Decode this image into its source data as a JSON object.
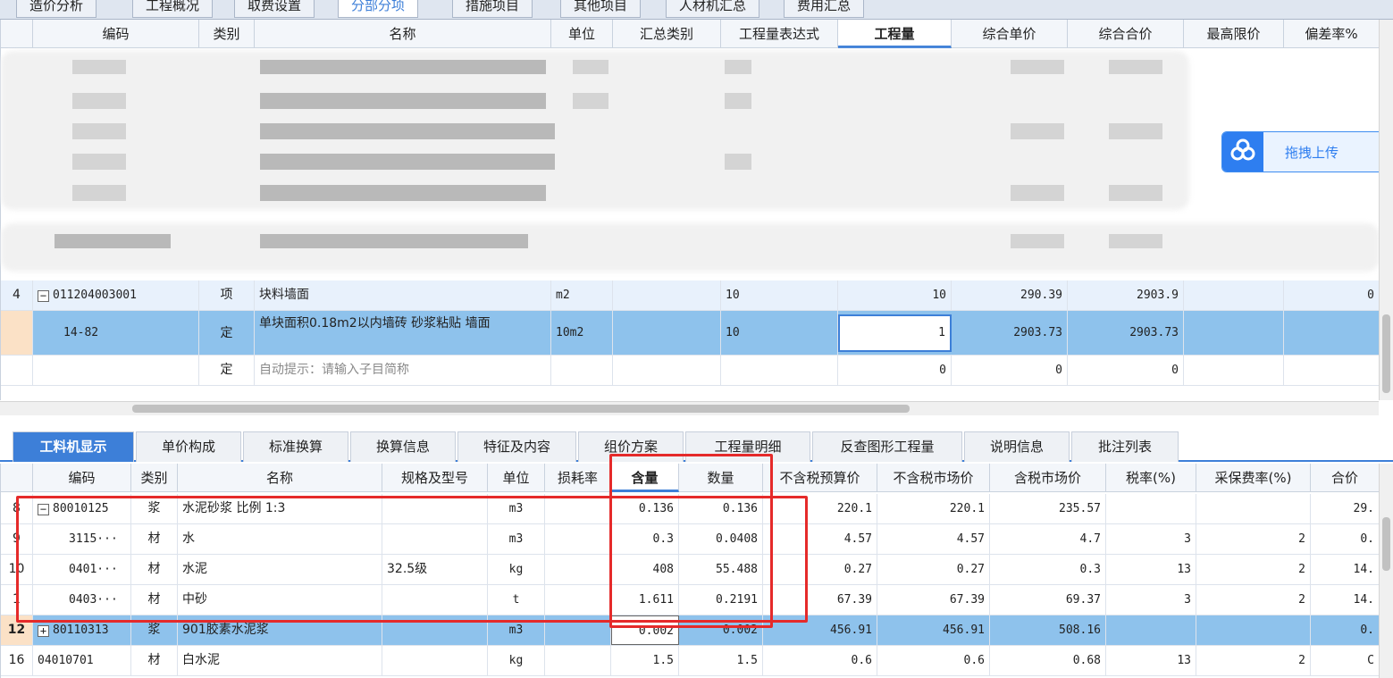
{
  "top_tabs": [
    "造价分析",
    "工程概况",
    "取费设置",
    "分部分项",
    "措施项目",
    "其他项目",
    "人材机汇总",
    "费用汇总"
  ],
  "upper": {
    "columns": [
      "编码",
      "类别",
      "名称",
      "单位",
      "汇总类别",
      "工程量表达式",
      "工程量",
      "综合单价",
      "综合合价",
      "最高限价",
      "偏差率%"
    ],
    "upload_label": "拖拽上传",
    "rows": [
      {
        "no": "4",
        "code": "011204003001",
        "type": "项",
        "name": "块料墙面",
        "unit": "m2",
        "expr": "10",
        "qty": "10",
        "unit_price": "290.39",
        "total": "2903.9",
        "dev": "0"
      },
      {
        "no": "",
        "code": "14-82",
        "type": "定",
        "name": "单块面积0.18m2以内墙砖 砂浆粘贴 墙面",
        "unit": "10m2",
        "expr": "10",
        "qty": "1",
        "unit_price": "2903.73",
        "total": "2903.73",
        "dev": ""
      },
      {
        "no": "",
        "code": "",
        "type": "定",
        "name": "自动提示：请输入子目简称",
        "unit": "",
        "expr": "",
        "qty": "0",
        "unit_price": "0",
        "total": "0",
        "dev": ""
      }
    ]
  },
  "lower_tabs": [
    "工料机显示",
    "单价构成",
    "标准换算",
    "换算信息",
    "特征及内容",
    "组价方案",
    "工程量明细",
    "反查图形工程量",
    "说明信息",
    "批注列表"
  ],
  "lower": {
    "columns": [
      "编码",
      "类别",
      "名称",
      "规格及型号",
      "单位",
      "损耗率",
      "含量",
      "数量",
      "不含税预算价",
      "不含税市场价",
      "含税市场价",
      "税率(%)",
      "采保费率(%)",
      "合价"
    ],
    "rows": [
      {
        "no": "8",
        "code": "80010125",
        "type": "浆",
        "name": "水泥砂浆 比例 1:3",
        "spec": "",
        "unit": "m3",
        "content": "0.136",
        "quantity": "0.136",
        "budget": "220.1",
        "market": "220.1",
        "tax_market": "235.57",
        "tax": "",
        "fee": "",
        "price": "29."
      },
      {
        "no": "9",
        "code": "3115···",
        "type": "材",
        "name": "水",
        "spec": "",
        "unit": "m3",
        "content": "0.3",
        "quantity": "0.0408",
        "budget": "4.57",
        "market": "4.57",
        "tax_market": "4.7",
        "tax": "3",
        "fee": "2",
        "price": "0."
      },
      {
        "no": "10",
        "code": "0401···",
        "type": "材",
        "name": "水泥",
        "spec": "32.5级",
        "unit": "kg",
        "content": "408",
        "quantity": "55.488",
        "budget": "0.27",
        "market": "0.27",
        "tax_market": "0.3",
        "tax": "13",
        "fee": "2",
        "price": "14."
      },
      {
        "no": "1",
        "code": "0403···",
        "type": "材",
        "name": "中砂",
        "spec": "",
        "unit": "t",
        "content": "1.611",
        "quantity": "0.2191",
        "budget": "67.39",
        "market": "67.39",
        "tax_market": "69.37",
        "tax": "3",
        "fee": "2",
        "price": "14."
      },
      {
        "no": "12",
        "code": "80110313",
        "type": "浆",
        "name": "901胶素水泥浆",
        "spec": "",
        "unit": "m3",
        "content": "0.002",
        "quantity": "0.002",
        "budget": "456.91",
        "market": "456.91",
        "tax_market": "508.16",
        "tax": "",
        "fee": "",
        "price": "0."
      },
      {
        "no": "16",
        "code": "04010701",
        "type": "材",
        "name": "白水泥",
        "spec": "",
        "unit": "kg",
        "content": "1.5",
        "quantity": "1.5",
        "budget": "0.6",
        "market": "0.6",
        "tax_market": "0.68",
        "tax": "13",
        "fee": "2",
        "price": "C"
      }
    ]
  }
}
